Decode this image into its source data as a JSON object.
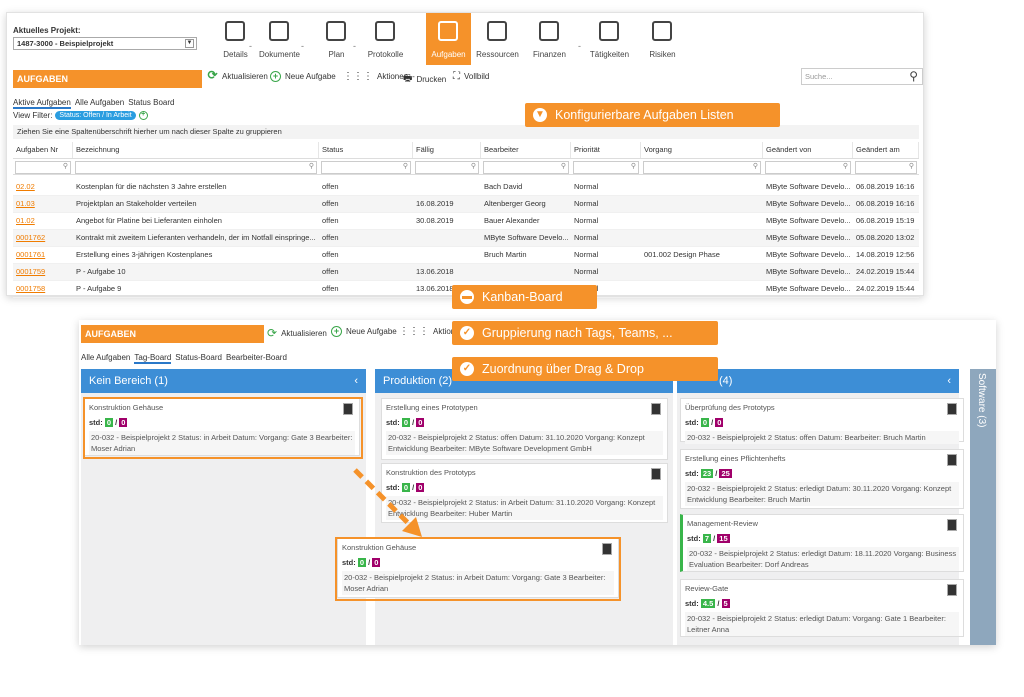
{
  "top": {
    "project_label": "Aktuelles Projekt:",
    "project_value": "1487-3000 - Beispielprojekt",
    "nav": [
      {
        "label": "Details",
        "icon": "sliders-icon"
      },
      {
        "label": "Dokumente",
        "icon": "documents-icon"
      },
      {
        "label": "Plan",
        "icon": "plan-icon"
      },
      {
        "label": "Protokolle",
        "icon": "protocol-icon"
      },
      {
        "label": "Aufgaben",
        "icon": "tasks-icon"
      },
      {
        "label": "Ressourcen",
        "icon": "resources-icon"
      },
      {
        "label": "Finanzen",
        "icon": "finance-icon"
      },
      {
        "label": "Tätigkeiten",
        "icon": "activities-icon"
      },
      {
        "label": "Risiken",
        "icon": "risk-icon"
      }
    ],
    "title": "AUFGABEN",
    "toolbar": {
      "refresh": "Aktualisieren",
      "new": "Neue Aufgabe",
      "actions": "Aktionen",
      "print": "Drucken",
      "fullscreen": "Vollbild",
      "search_placeholder": "Suche..."
    },
    "tabs": [
      "Aktive Aufgaben",
      "Alle Aufgaben",
      "Status Board"
    ],
    "filter_label": "View Filter:",
    "filter_value": "Status: Offen / In Arbeit",
    "group_hint": "Ziehen Sie eine Spaltenüberschrift hierher um nach dieser Spalte zu gruppieren",
    "columns": [
      "Aufgaben Nr",
      "Bezeichnung",
      "Status",
      "Fällig",
      "Bearbeiter",
      "Priorität",
      "Vorgang",
      "Geändert von",
      "Geändert am"
    ],
    "rows": [
      [
        "02.02",
        "Kostenplan für die nächsten 3 Jahre erstellen",
        "offen",
        "",
        "Bach David",
        "Normal",
        "",
        "MByte Software Develo...",
        "06.08.2019 16:16"
      ],
      [
        "01.03",
        "Projektplan an Stakeholder verteilen",
        "offen",
        "16.08.2019",
        "Altenberger Georg",
        "Normal",
        "",
        "MByte Software Develo...",
        "06.08.2019 16:16"
      ],
      [
        "01.02",
        "Angebot für Platine bei Lieferanten einholen",
        "offen",
        "30.08.2019",
        "Bauer Alexander",
        "Normal",
        "",
        "MByte Software Develo...",
        "06.08.2019 15:19"
      ],
      [
        "0001762",
        "Kontrakt mit zweitem Lieferanten verhandeln, der im Notfall einspringe...",
        "offen",
        "",
        "MByte Software Develo...",
        "Normal",
        "",
        "MByte Software Develo...",
        "05.08.2020 13:02"
      ],
      [
        "0001761",
        "Erstellung eines 3-jährigen Kostenplanes",
        "offen",
        "",
        "Bruch Martin",
        "Normal",
        "001.002 Design Phase",
        "MByte Software Develo...",
        "14.08.2019 12:56"
      ],
      [
        "0001759",
        "P - Aufgabe 10",
        "offen",
        "13.06.2018",
        "",
        "Normal",
        "",
        "MByte Software Develo...",
        "24.02.2019 15:44"
      ],
      [
        "0001758",
        "P - Aufgabe 9",
        "offen",
        "13.06.2018",
        "",
        "Normal",
        "",
        "MByte Software Develo...",
        "24.02.2019 15:44"
      ]
    ]
  },
  "callouts": [
    "Konfigurierbare Aufgaben Listen",
    "Kanban-Board",
    "Gruppierung nach Tags, Teams, ...",
    "Zuordnung über Drag & Drop"
  ],
  "board": {
    "title": "AUFGABEN",
    "refresh": "Aktualisieren",
    "new": "Neue Aufgabe",
    "actions": "Aktionen",
    "tabs": [
      "Alle Aufgaben",
      "Tag-Board",
      "Status-Board",
      "Bearbeiter-Board"
    ],
    "columns": [
      "Kein Bereich (1)",
      "Produktion (2)",
      "(4)"
    ],
    "side_column": "Software (3)",
    "cards": {
      "k1": {
        "title": "Konstruktion Gehäuse",
        "a": "0",
        "b": "0",
        "info": "20-032 - Beispielprojekt 2  Status: in Arbeit  Datum:   Vorgang: Gate 3  Bearbeiter: Moser Adrian"
      },
      "p1": {
        "title": "Erstellung eines Prototypen",
        "a": "0",
        "b": "0",
        "info": "20-032 - Beispielprojekt 2  Status: offen  Datum: 31.10.2020  Vorgang: Konzept Entwicklung  Bearbeiter: MByte Software Development GmbH"
      },
      "p2": {
        "title": "Konstruktion des Prototyps",
        "a": "0",
        "b": "0",
        "info": "20-032 - Beispielprojekt 2  Status: in Arbeit  Datum: 31.10.2020  Vorgang: Konzept Entwicklung  Bearbeiter: Huber Martin"
      },
      "drag": {
        "title": "Konstruktion Gehäuse",
        "a": "0",
        "b": "0",
        "info": "20-032 - Beispielprojekt 2  Status: in Arbeit  Datum:   Vorgang: Gate 3  Bearbeiter: Moser Adrian"
      },
      "s1": {
        "title": "Überprüfung des Prototyps",
        "a": "0",
        "b": "0",
        "info": "20-032 - Beispielprojekt 2  Status: offen  Datum:   Bearbeiter: Bruch Martin"
      },
      "s2": {
        "title": "Erstellung eines Pflichtenhefts",
        "a": "23",
        "b": "25",
        "info": "20-032 - Beispielprojekt 2  Status: erledigt  Datum: 30.11.2020  Vorgang: Konzept Entwicklung  Bearbeiter: Bruch Martin"
      },
      "s3": {
        "title": "Management-Review",
        "a": "7",
        "b": "15",
        "info": "20-032 - Beispielprojekt 2  Status: erledigt  Datum: 18.11.2020  Vorgang: Business Evaluation  Bearbeiter: Dorf Andreas"
      },
      "s4": {
        "title": "Review-Gate",
        "a": "4.5",
        "b": "5",
        "info": "20-032 - Beispielprojekt 2  Status: erledigt  Datum:   Vorgang: Gate 1  Bearbeiter: Leitner Anna"
      }
    },
    "std": "std:"
  },
  "colors": {
    "accent": "#f5922a",
    "column_header": "#3d8ed6",
    "green": "#39b54a",
    "purple": "#a0006a"
  }
}
